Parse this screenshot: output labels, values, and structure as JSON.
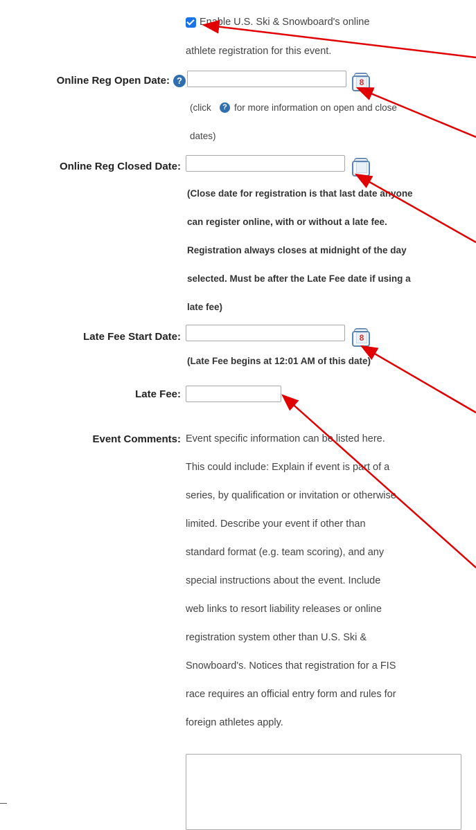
{
  "enable_registration": {
    "checked": true,
    "line1": "Enable U.S. Ski & Snowboard's online",
    "line2": "athlete registration for this event."
  },
  "open_date": {
    "label": "Online Reg Open Date:",
    "value": "",
    "help_icon": "question-circle-icon",
    "calendar_icon": "calendar-icon",
    "calendar_number": "8",
    "note_prefix": "(click",
    "note_suffix": "for more information on open and close",
    "note_line2": "dates)"
  },
  "closed_date": {
    "label": "Online Reg Closed Date:",
    "value": "",
    "calendar_icon": "calendar-icon",
    "notes": [
      "(Close date for registration is that last date anyone",
      "can register online, with or without a late fee.",
      "Registration always closes at midnight of the day",
      "selected. Must be after the Late Fee date if using a",
      "late fee)"
    ]
  },
  "late_fee_start": {
    "label": "Late Fee Start Date:",
    "value": "",
    "calendar_icon": "calendar-icon",
    "calendar_number": "8",
    "note": "(Late Fee begins at 12:01 AM of this date)"
  },
  "late_fee": {
    "label": "Late Fee:",
    "value": ""
  },
  "event_comments": {
    "label": "Event Comments:",
    "lines": [
      "Event specific information can be listed here.",
      "This could include: Explain if event is part of a",
      "series, by qualification or invitation or otherwise",
      "limited. Describe your event if other than",
      "standard format (e.g. team scoring), and any",
      "special instructions about the event. Include",
      "web links to resort liability releases or online",
      "registration system other than U.S. Ski &",
      "Snowboard's. Notices that registration for a FIS",
      "race requires an official entry form and rules for",
      "foreign athletes apply."
    ],
    "value": ""
  },
  "colors": {
    "annotation_arrow": "#e00000",
    "checkbox": "#1a73e8",
    "help_icon": "#2f6fb0",
    "calendar_frame": "#5b84b1",
    "calendar_number": "#d9302c"
  }
}
